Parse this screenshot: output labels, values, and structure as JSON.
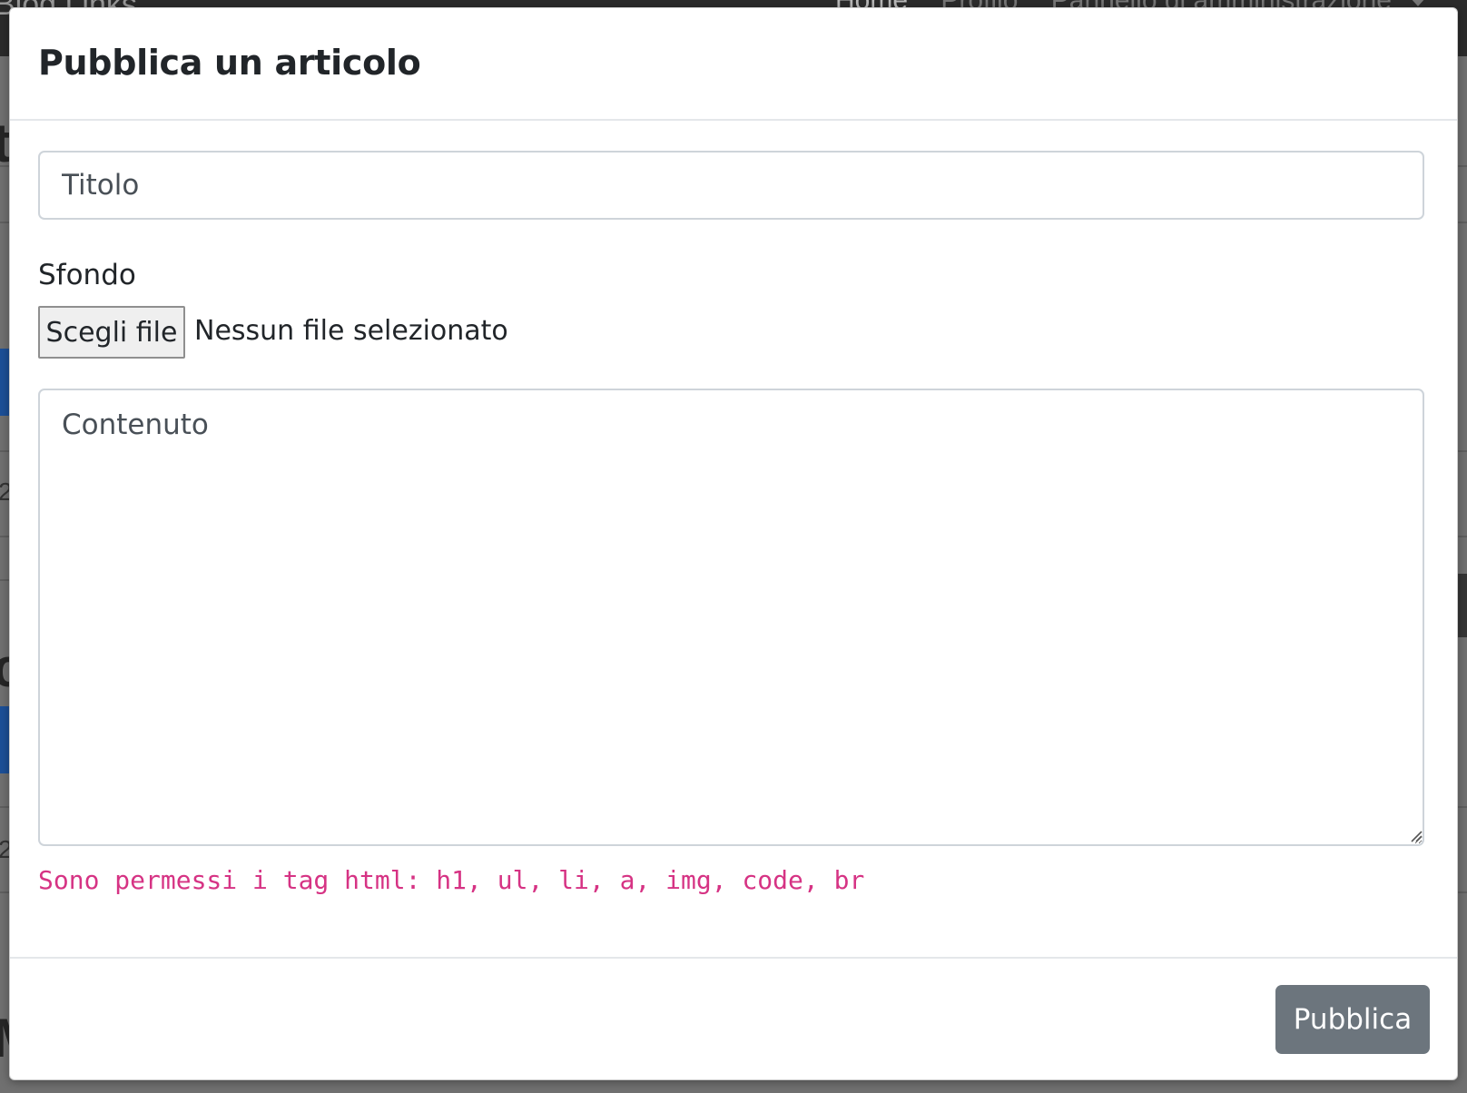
{
  "background_page": {
    "brand": "Blog Links",
    "nav_links": [
      "Home",
      "Profilo",
      "Pannello di amministrazione"
    ]
  },
  "modal": {
    "title": "Pubblica un articolo",
    "title_input": {
      "placeholder": "Titolo",
      "value": ""
    },
    "background_label": "Sfondo",
    "file_input": {
      "button_label": "Scegli file",
      "status": "Nessun file selezionato"
    },
    "content_textarea": {
      "placeholder": "Contenuto",
      "value": ""
    },
    "allowed_tags_hint": "Sono permessi i tag html: h1, ul, li, a, img, code, br",
    "publish_button_label": "Pubblica"
  },
  "colors": {
    "hint_text": "#d63384",
    "publish_button": "#6c757d",
    "overlay": "#707070",
    "input_border": "#ced4da"
  },
  "icons": {
    "resize_handle": "textarea-resize-icon"
  }
}
